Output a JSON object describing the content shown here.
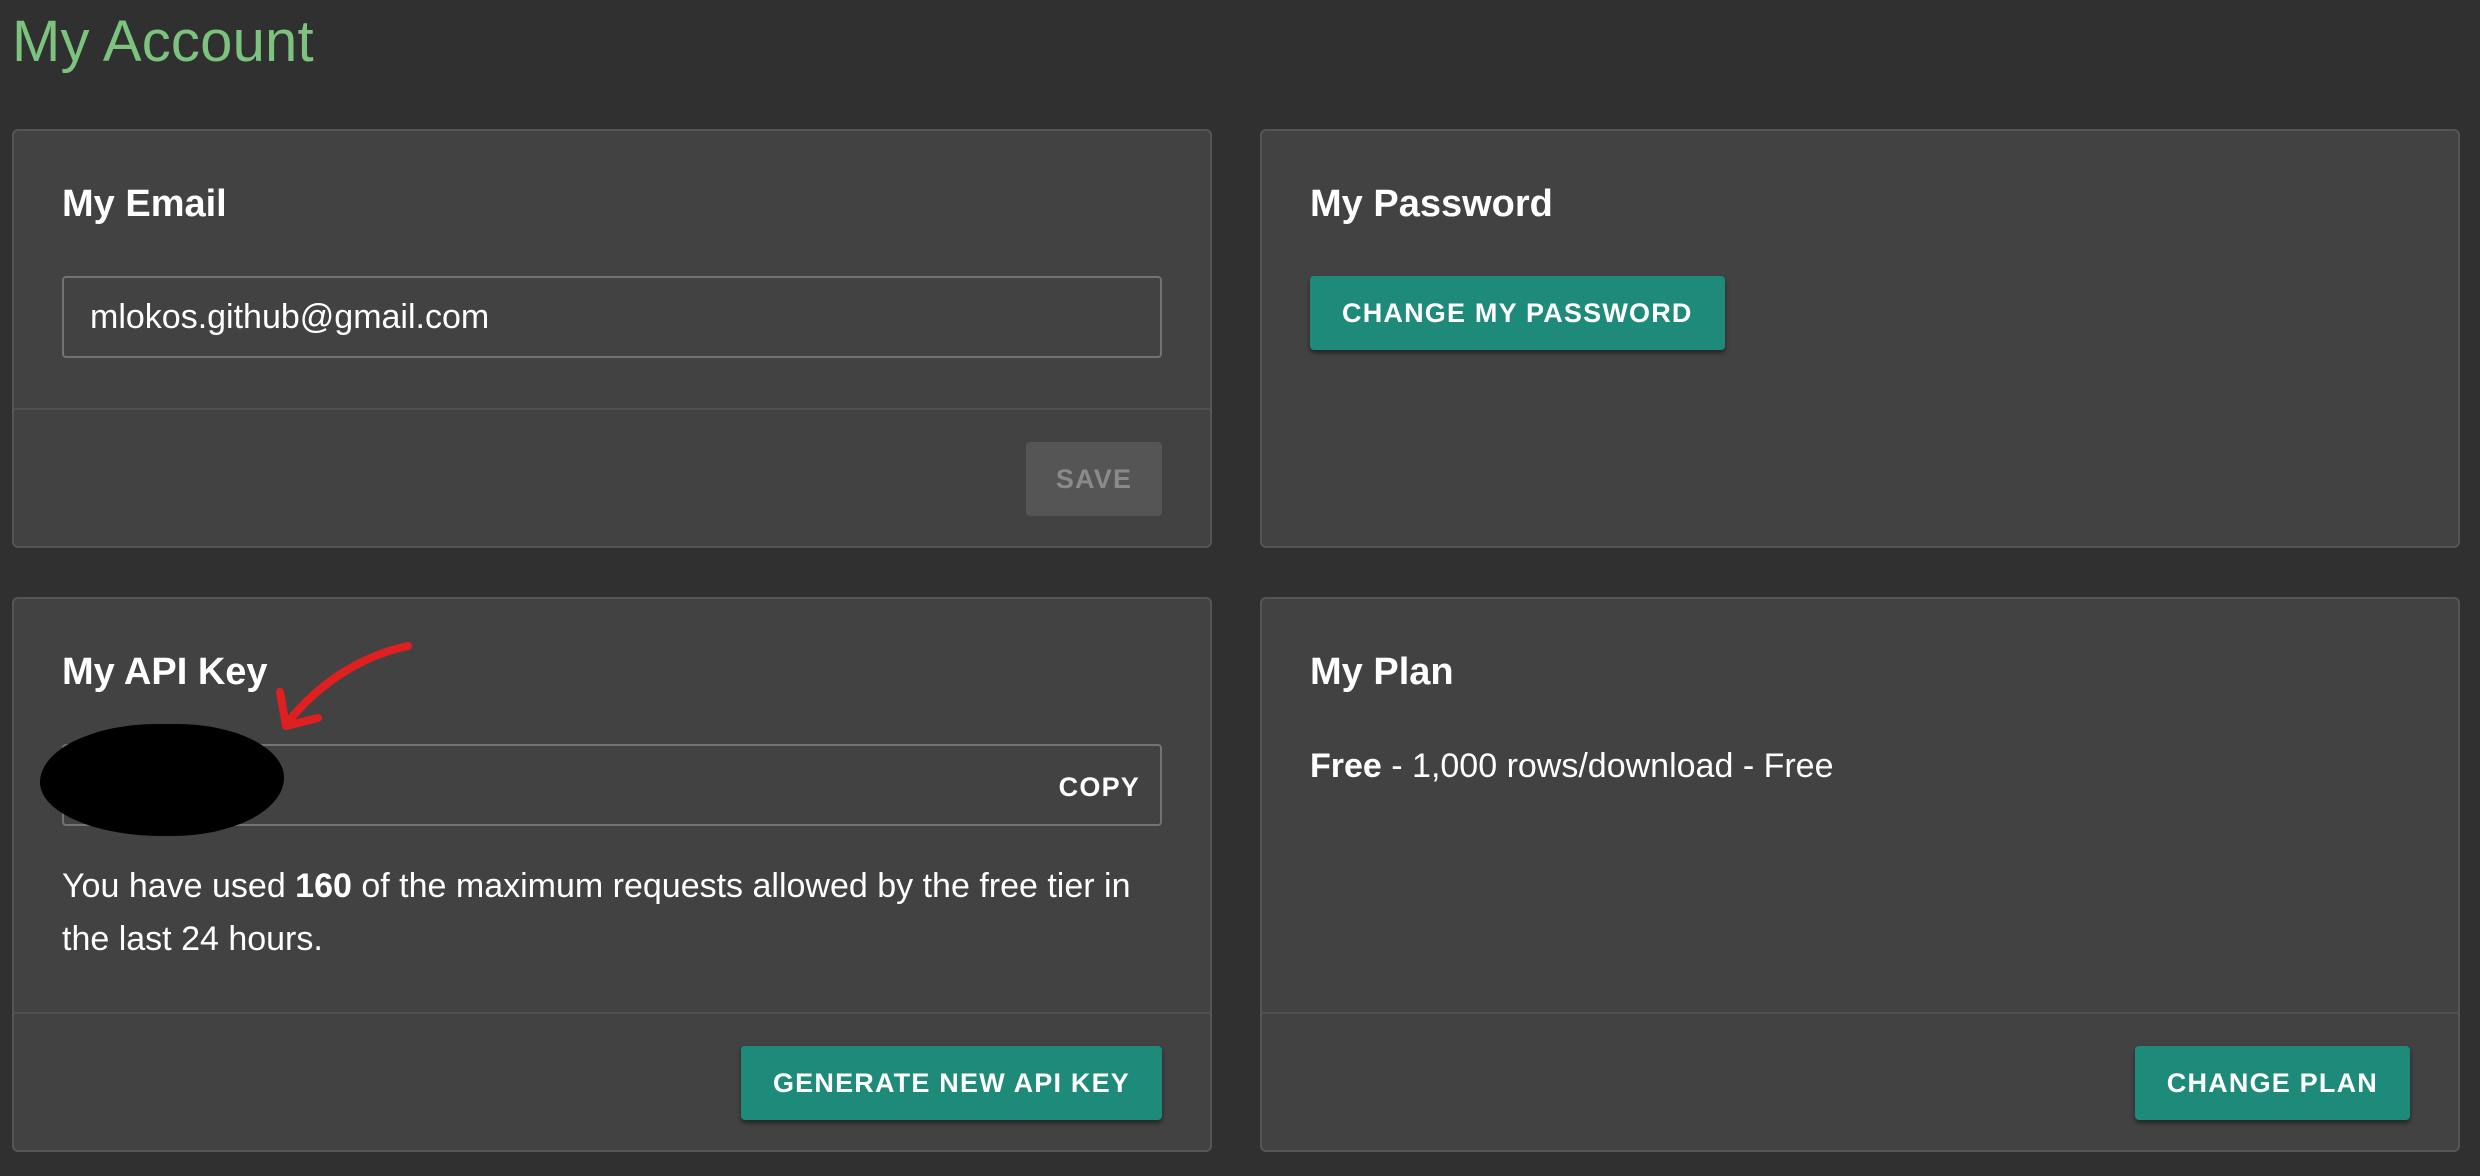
{
  "page": {
    "title": "My Account"
  },
  "email_card": {
    "title": "My Email",
    "email_value": "mlokos.github@gmail.com",
    "save_label": "SAVE"
  },
  "password_card": {
    "title": "My Password",
    "change_label": "CHANGE MY PASSWORD"
  },
  "api_card": {
    "title": "My API Key",
    "copy_label": "COPY",
    "usage_prefix": "You have used ",
    "usage_count": "160",
    "usage_suffix": " of the maximum requests allowed by the free tier in the last 24 hours.",
    "generate_label": "GENERATE NEW API KEY"
  },
  "plan_card": {
    "title": "My Plan",
    "plan_name": "Free",
    "plan_details": " - 1,000 rows/download - Free",
    "change_label": "CHANGE PLAN"
  },
  "colors": {
    "background": "#303030",
    "card": "#424242",
    "accent": "#7cc37f",
    "button": "#1e8a7a",
    "annotation": "#e02020"
  },
  "icons": {
    "annotation_arrow": "red-arrow-icon"
  }
}
